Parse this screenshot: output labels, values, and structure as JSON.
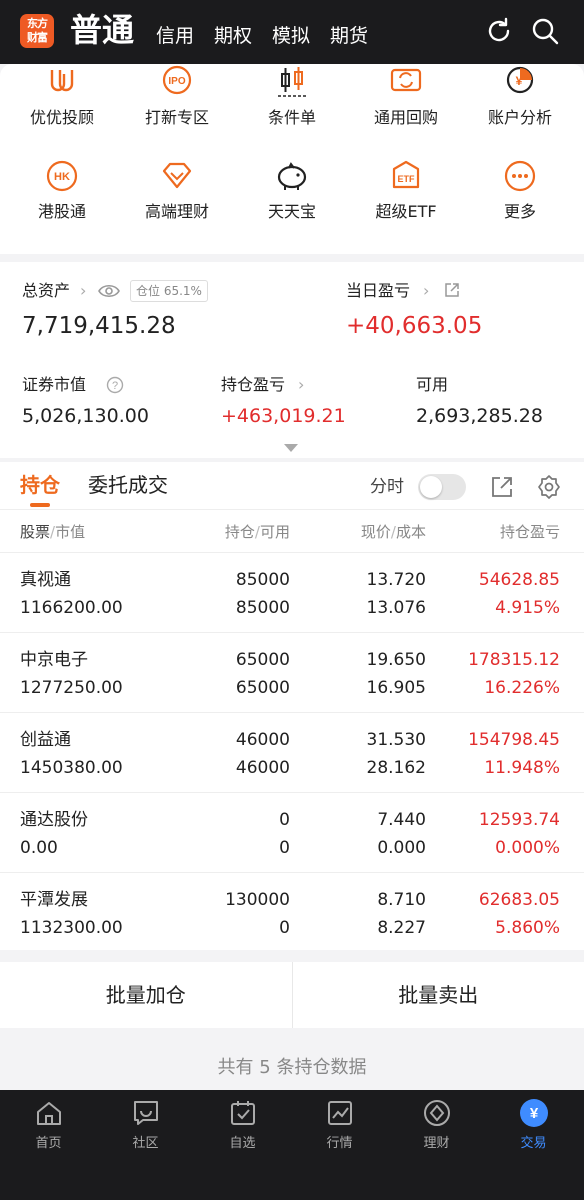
{
  "header": {
    "logo_text_1": "东方",
    "logo_text_2": "财富",
    "mode": "普通",
    "tabs": [
      "信用",
      "期权",
      "模拟",
      "期货"
    ],
    "icons": [
      "refresh-icon",
      "search-icon"
    ]
  },
  "quick_menu": [
    {
      "label": "优优投顾",
      "icon": "uu-advisor-icon"
    },
    {
      "label": "打新专区",
      "icon": "ipo-icon",
      "badge": "IPO"
    },
    {
      "label": "条件单",
      "icon": "candlestick-icon"
    },
    {
      "label": "通用回购",
      "icon": "repo-icon"
    },
    {
      "label": "账户分析",
      "icon": "account-analysis-icon"
    },
    {
      "label": "港股通",
      "icon": "hk-icon",
      "badge": "HK"
    },
    {
      "label": "高端理财",
      "icon": "diamond-icon"
    },
    {
      "label": "天天宝",
      "icon": "piggy-bank-icon"
    },
    {
      "label": "超级ETF",
      "icon": "etf-icon",
      "badge": "ETF"
    },
    {
      "label": "更多",
      "icon": "more-icon"
    }
  ],
  "assets": {
    "total_label": "总资产",
    "position_badge": "仓位 65.1%",
    "total_value": "7,719,415.28",
    "daily_pl_label": "当日盈亏",
    "daily_pl_value": "+40,663.05",
    "market_value_label": "证券市值",
    "market_value": "5,026,130.00",
    "holding_pl_label": "持仓盈亏",
    "holding_pl_value": "+463,019.21",
    "available_label": "可用",
    "available_value": "2,693,285.28"
  },
  "tabs": {
    "holdings": "持仓",
    "orders": "委托成交",
    "intraday_label": "分时"
  },
  "table": {
    "headers": {
      "stock": "股票",
      "market_value": "市值",
      "position": "持仓",
      "available": "可用",
      "price": "现价",
      "cost": "成本",
      "pl": "持仓盈亏"
    },
    "rows": [
      {
        "name": "真视通",
        "market_value": "1166200.00",
        "position": "85000",
        "available": "85000",
        "price": "13.720",
        "cost": "13.076",
        "pl": "54628.85",
        "pl_pct": "4.915%"
      },
      {
        "name": "中京电子",
        "market_value": "1277250.00",
        "position": "65000",
        "available": "65000",
        "price": "19.650",
        "cost": "16.905",
        "pl": "178315.12",
        "pl_pct": "16.226%"
      },
      {
        "name": "创益通",
        "market_value": "1450380.00",
        "position": "46000",
        "available": "46000",
        "price": "31.530",
        "cost": "28.162",
        "pl": "154798.45",
        "pl_pct": "11.948%"
      },
      {
        "name": "通达股份",
        "market_value": "0.00",
        "position": "0",
        "available": "0",
        "price": "7.440",
        "cost": "0.000",
        "pl": "12593.74",
        "pl_pct": "0.000%"
      },
      {
        "name": "平潭发展",
        "market_value": "1132300.00",
        "position": "130000",
        "available": "0",
        "price": "8.710",
        "cost": "8.227",
        "pl": "62683.05",
        "pl_pct": "5.860%"
      }
    ]
  },
  "batch": {
    "add": "批量加仓",
    "sell": "批量卖出"
  },
  "summary": "共有 5 条持仓数据",
  "bottom_nav": [
    {
      "label": "首页",
      "icon": "home-icon"
    },
    {
      "label": "社区",
      "icon": "community-icon"
    },
    {
      "label": "自选",
      "icon": "watchlist-icon"
    },
    {
      "label": "行情",
      "icon": "market-icon"
    },
    {
      "label": "理财",
      "icon": "wealth-icon"
    },
    {
      "label": "交易",
      "icon": "trade-icon",
      "active": true
    }
  ],
  "colors": {
    "accent": "#ee6a1f",
    "up_red": "#e12d2d",
    "header_bg": "#1b1b1d",
    "active_blue": "#3f8cff"
  }
}
